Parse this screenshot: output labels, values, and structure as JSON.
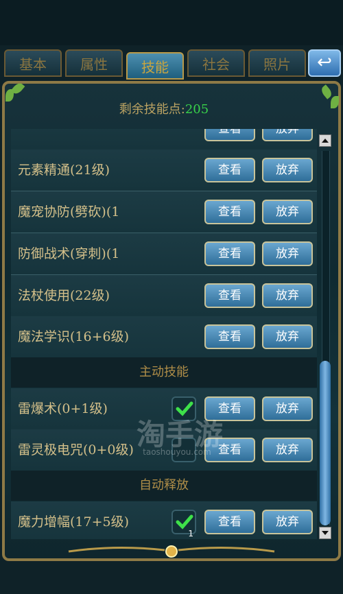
{
  "tabs": [
    {
      "label": "基本"
    },
    {
      "label": "属性"
    },
    {
      "label": "技能",
      "active": true
    },
    {
      "label": "社会"
    },
    {
      "label": "照片"
    }
  ],
  "header": {
    "prefix": "剩余技能点:",
    "points": "205"
  },
  "rows": [
    {
      "type": "skill",
      "name": "",
      "view": "查看",
      "drop": "放弃"
    },
    {
      "type": "skill",
      "name": "元素精通(21级)",
      "view": "查看",
      "drop": "放弃"
    },
    {
      "type": "skill",
      "name": "魔宠协防(劈砍)(1",
      "view": "查看",
      "drop": "放弃"
    },
    {
      "type": "skill",
      "name": "防御战术(穿刺)(1",
      "view": "查看",
      "drop": "放弃"
    },
    {
      "type": "skill",
      "name": "法杖使用(22级)",
      "view": "查看",
      "drop": "放弃"
    },
    {
      "type": "skill",
      "name": "魔法学识(16+6级)",
      "view": "查看",
      "drop": "放弃"
    },
    {
      "type": "section",
      "title": "主动技能"
    },
    {
      "type": "skill",
      "name": "雷爆术(0+1级)",
      "view": "查看",
      "drop": "放弃",
      "checked": true
    },
    {
      "type": "skill",
      "name": "雷灵极电咒(0+0级)",
      "view": "查看",
      "drop": "放弃",
      "checked": false
    },
    {
      "type": "section",
      "title": "自动释放"
    },
    {
      "type": "skill",
      "name": "魔力增幅(17+5级)",
      "view": "查看",
      "drop": "放弃",
      "checked": true,
      "slot": "1"
    }
  ],
  "watermark": {
    "logo": "淘手游",
    "url": "taoshouyou.com"
  },
  "colors": {
    "gold": "#bda463",
    "points_green": "#39d24a",
    "button_blue": "#2f6e99"
  }
}
